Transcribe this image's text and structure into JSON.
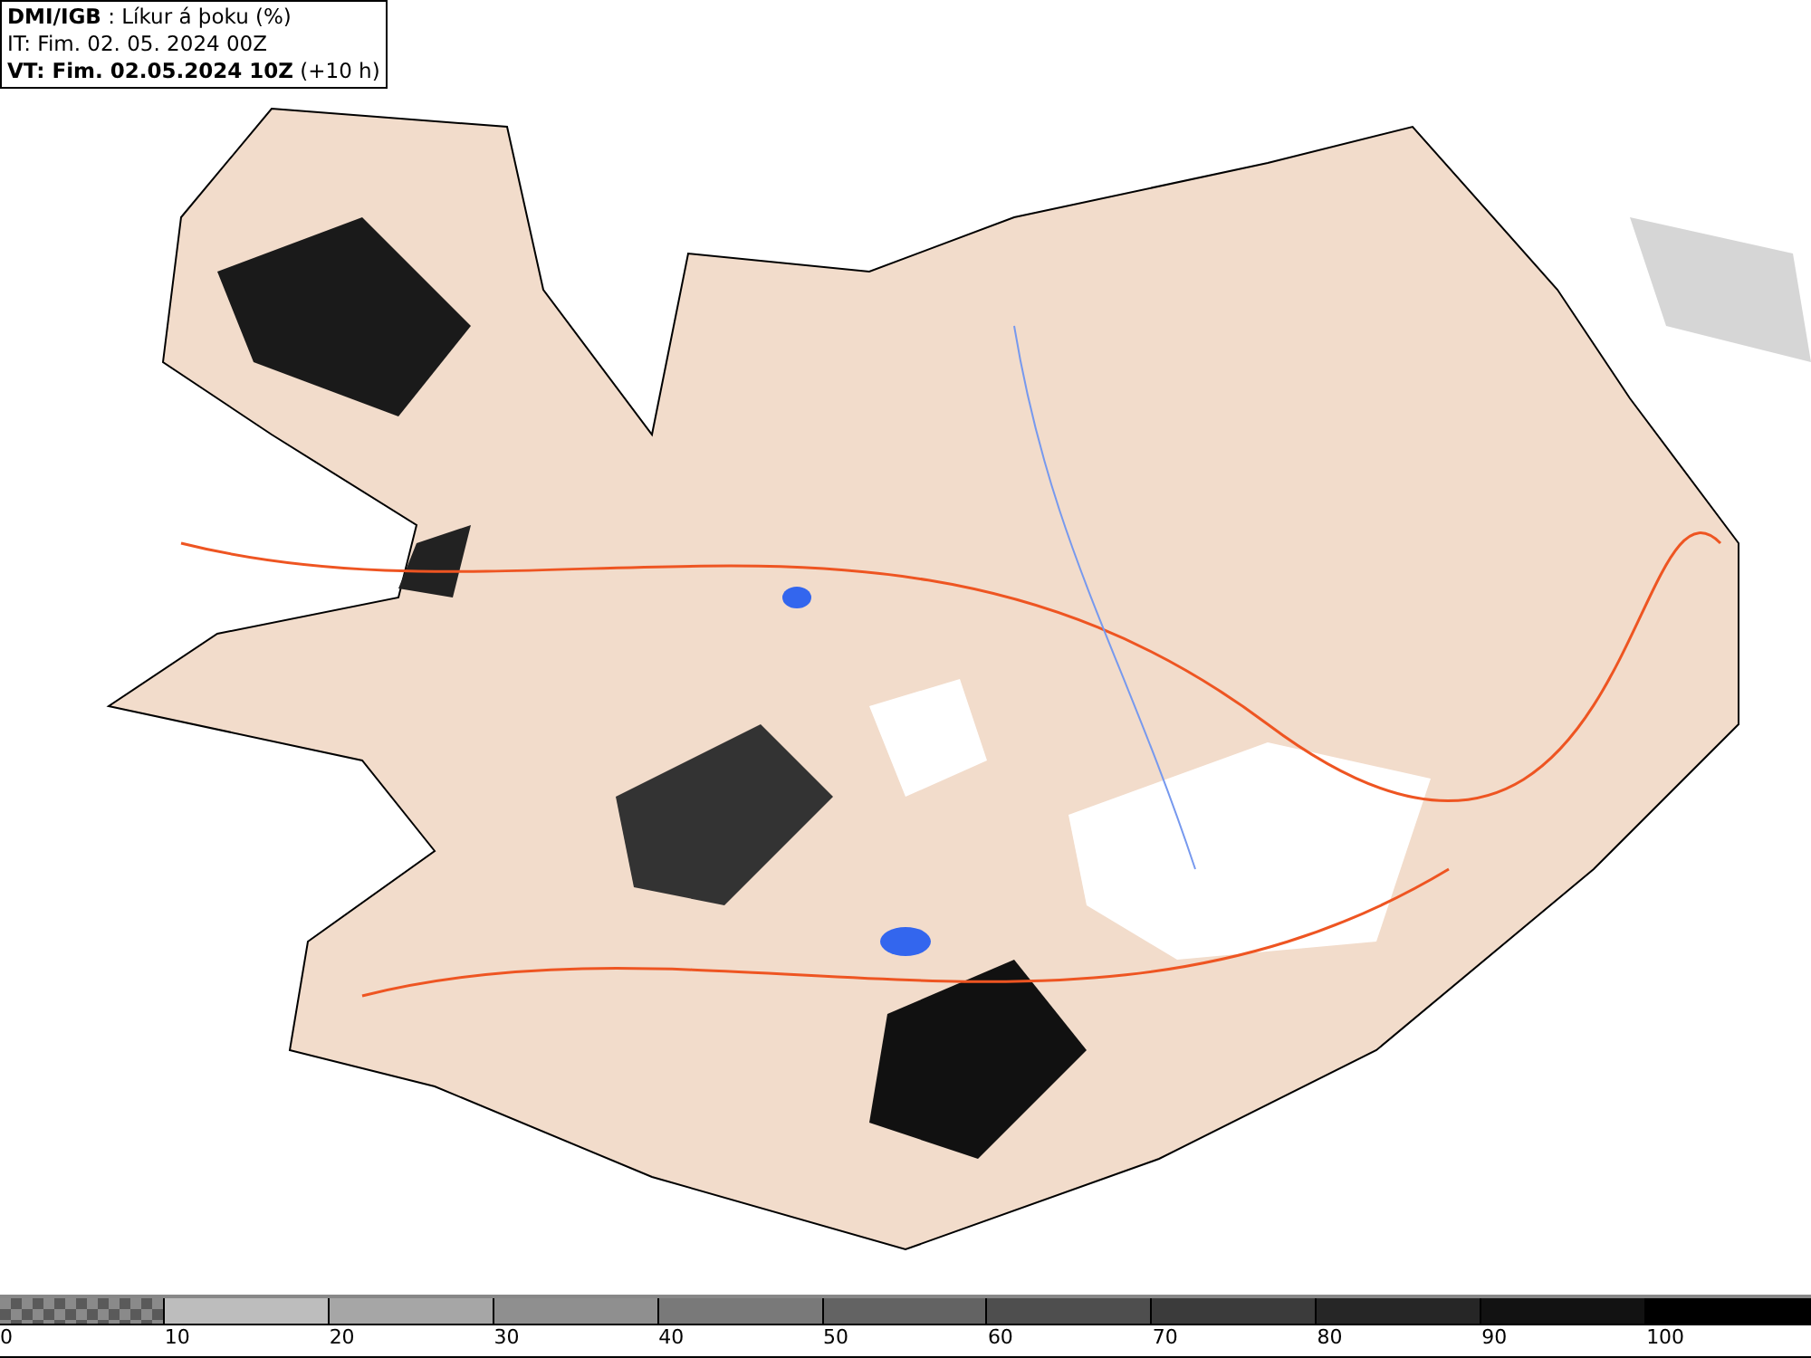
{
  "header": {
    "lines": [
      "**DMI/IGB** : Líkur á þoku (%)",
      "IT: Fim. 02. 05. 2024 00Z",
      "**VT: Fim. 02.05.2024 10Z** (+10 h)"
    ]
  },
  "legend": {
    "segments": [
      {
        "kind": "checker",
        "color": "#5a5a5a",
        "label": "0"
      },
      {
        "kind": "solid",
        "color": "#bdbdbd",
        "label": "10"
      },
      {
        "kind": "solid",
        "color": "#a6a6a6",
        "label": "20"
      },
      {
        "kind": "solid",
        "color": "#8f8f8f",
        "label": "30"
      },
      {
        "kind": "solid",
        "color": "#797979",
        "label": "40"
      },
      {
        "kind": "solid",
        "color": "#636363",
        "label": "50"
      },
      {
        "kind": "solid",
        "color": "#4e4e4e",
        "label": "60"
      },
      {
        "kind": "solid",
        "color": "#3b3b3b",
        "label": "70"
      },
      {
        "kind": "solid",
        "color": "#262626",
        "label": "80"
      },
      {
        "kind": "solid",
        "color": "#121212",
        "label": "90"
      },
      {
        "kind": "solid",
        "color": "#000000",
        "label": "100"
      }
    ]
  }
}
